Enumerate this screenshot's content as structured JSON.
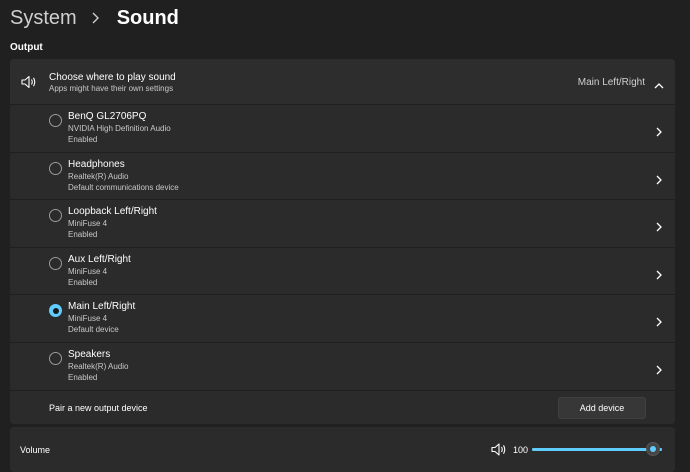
{
  "breadcrumb": {
    "parent": "System",
    "current": "Sound"
  },
  "output": {
    "section_title": "Output",
    "header": {
      "title": "Choose where to play sound",
      "subtitle": "Apps might have their own settings",
      "selected_value": "Main Left/Right",
      "icon": "speaker-icon"
    },
    "devices": [
      {
        "name": "BenQ GL2706PQ",
        "driver": "NVIDIA High Definition Audio",
        "status": "Enabled",
        "selected": false
      },
      {
        "name": "Headphones",
        "driver": "Realtek(R) Audio",
        "status": "Default communications device",
        "selected": false
      },
      {
        "name": "Loopback Left/Right",
        "driver": "MiniFuse 4",
        "status": "Enabled",
        "selected": false
      },
      {
        "name": "Aux Left/Right",
        "driver": "MiniFuse 4",
        "status": "Enabled",
        "selected": false
      },
      {
        "name": "Main Left/Right",
        "driver": "MiniFuse 4",
        "status": "Default device",
        "selected": true
      },
      {
        "name": "Speakers",
        "driver": "Realtek(R) Audio",
        "status": "Enabled",
        "selected": false
      }
    ],
    "pair": {
      "label": "Pair a new output device",
      "button_label": "Add device"
    }
  },
  "volume": {
    "label": "Volume",
    "value": "100",
    "level_percent": 100,
    "icon": "volume-icon"
  },
  "colors": {
    "accent": "#60cdff",
    "background": "#202020",
    "card": "#2b2b2b"
  }
}
